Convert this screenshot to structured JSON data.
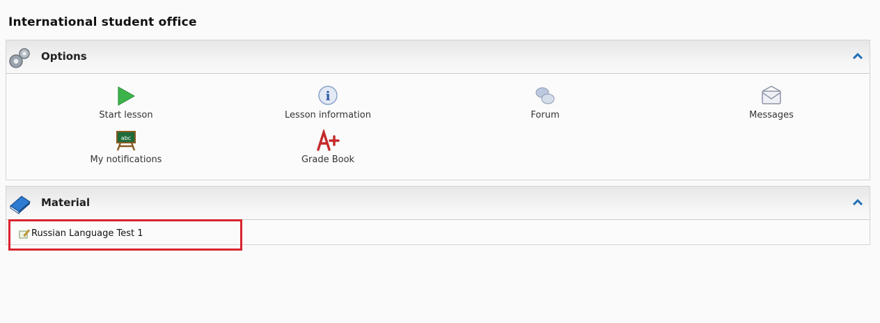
{
  "page": {
    "title": "International student office"
  },
  "options": {
    "header": "Options",
    "items": [
      {
        "label": "Start lesson",
        "icon": "play-icon"
      },
      {
        "label": "Lesson information",
        "icon": "info-icon"
      },
      {
        "label": "Forum",
        "icon": "forum-icon"
      },
      {
        "label": "Messages",
        "icon": "envelope-icon"
      },
      {
        "label": "My notifications",
        "icon": "blackboard-icon"
      },
      {
        "label": "Grade Book",
        "icon": "grade-a-plus-icon"
      }
    ]
  },
  "material": {
    "header": "Material",
    "items": [
      {
        "label": "Russian Language Test 1",
        "icon": "quiz-edit-icon"
      }
    ]
  },
  "colors": {
    "highlight": "#d9232d",
    "chevron": "#1f6fb5"
  }
}
